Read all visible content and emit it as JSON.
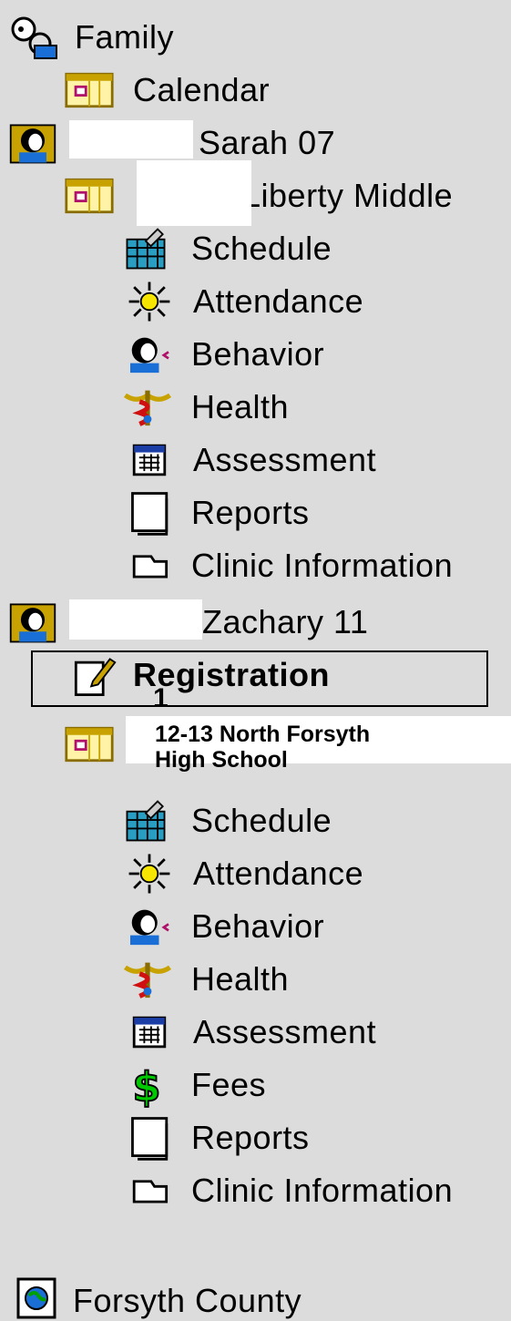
{
  "tree": {
    "family": {
      "label": "Family",
      "icon": "family-icon"
    },
    "calendar": {
      "label": "Calendar",
      "icon": "calendar-icon"
    },
    "student1": {
      "label": "Sarah 07",
      "icon": "student-icon",
      "school": {
        "label": "Liberty Middle",
        "icon": "calendar-icon"
      },
      "items": [
        {
          "label": "Schedule",
          "icon": "schedule-icon"
        },
        {
          "label": "Attendance",
          "icon": "attendance-icon"
        },
        {
          "label": "Behavior",
          "icon": "behavior-icon"
        },
        {
          "label": "Health",
          "icon": "health-icon"
        },
        {
          "label": "Assessment",
          "icon": "assessment-icon"
        },
        {
          "label": "Reports",
          "icon": "reports-icon"
        },
        {
          "label": "Clinic Information",
          "icon": "clinic-icon"
        }
      ]
    },
    "student2": {
      "label": "Zachary 11",
      "icon": "student-icon",
      "registration": {
        "label": "Registration",
        "icon": "registration-icon",
        "marker": "1"
      },
      "school": {
        "label_line1": "12-13 North Forsyth",
        "label_line2": "High School",
        "icon": "calendar-icon"
      },
      "items": [
        {
          "label": "Schedule",
          "icon": "schedule-icon"
        },
        {
          "label": "Attendance",
          "icon": "attendance-icon"
        },
        {
          "label": "Behavior",
          "icon": "behavior-icon"
        },
        {
          "label": "Health",
          "icon": "health-icon"
        },
        {
          "label": "Assessment",
          "icon": "assessment-icon"
        },
        {
          "label": "Fees",
          "icon": "fees-icon"
        },
        {
          "label": "Reports",
          "icon": "reports-icon"
        },
        {
          "label": "Clinic Information",
          "icon": "clinic-icon"
        }
      ]
    },
    "district": {
      "label": "Forsyth County",
      "icon": "district-icon"
    }
  },
  "colors": {
    "background": "#dcdcdc",
    "calendar_frame": "#c8a200",
    "calendar_dot": "#b0106a",
    "fees_green": "#00c800"
  }
}
